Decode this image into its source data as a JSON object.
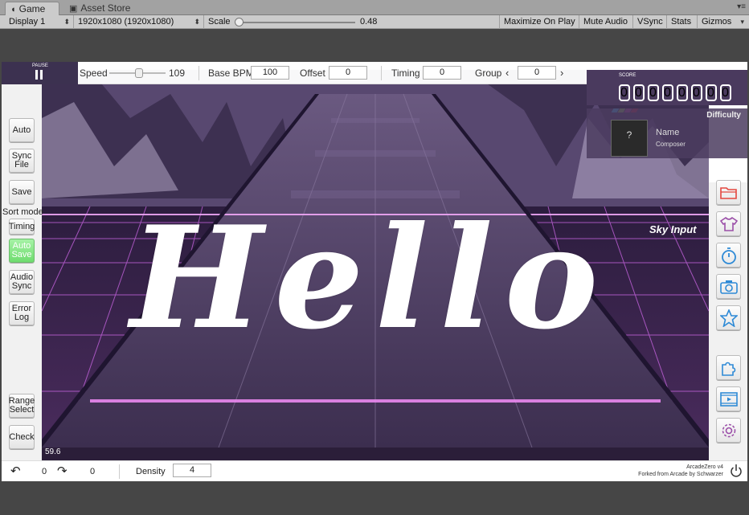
{
  "unity": {
    "tabs": [
      {
        "label": "Game",
        "icon": "pacman-icon"
      },
      {
        "label": "Asset Store",
        "icon": "bag-icon"
      }
    ],
    "toolbar": {
      "display": "Display 1",
      "resolution": "1920x1080 (1920x1080)",
      "scale_label": "Scale",
      "scale_value": "0.48",
      "scale_fraction": 0.0,
      "maximize": "Maximize On Play",
      "mute": "Mute Audio",
      "vsync": "VSync",
      "stats": "Stats",
      "gizmos": "Gizmos"
    }
  },
  "topbar": {
    "pause_label": "PAUSE",
    "speed_label": "Speed",
    "speed_value": "109",
    "speed_fraction": 0.5,
    "base_bpm_label": "Base BPM",
    "base_bpm_value": "100",
    "offset_label": "Offset",
    "offset_value": "0",
    "timing_label": "Timing",
    "timing_value": "0",
    "group_label": "Group",
    "group_value": "0"
  },
  "score": {
    "label": "SCORE",
    "digits": [
      "0",
      "0",
      "0",
      "0",
      "0",
      "0",
      "0",
      "0"
    ],
    "difficulty_label": "Difficulty",
    "song_name": "Name",
    "composer": "Composer",
    "jacket_glyph": "?"
  },
  "scene": {
    "overlay_text": "Hello",
    "sky_input": "Sky Input",
    "fps": "59.6"
  },
  "left_buttons": [
    {
      "label1": "Auto",
      "label2": ""
    },
    {
      "label1": "Sync",
      "label2": "File"
    },
    {
      "label1": "Save",
      "label2": ""
    },
    {
      "label1": "Timing",
      "label2": ""
    },
    {
      "label1": "Auto",
      "label2": "Save"
    },
    {
      "label1": "Audio",
      "label2": "Sync"
    },
    {
      "label1": "Error",
      "label2": "Log"
    },
    {
      "label1": "Range",
      "label2": "Select"
    },
    {
      "label1": "Check",
      "label2": ""
    }
  ],
  "sort_mode_label": "Sort mode",
  "right_buttons": [
    "folder-icon",
    "shirt-icon",
    "stopwatch-icon",
    "camera-icon",
    "star-icon",
    "puzzle-icon",
    "film-icon",
    "gear-icon"
  ],
  "bottombar": {
    "undo_count": "0",
    "redo_count": "0",
    "density_label": "Density",
    "density_value": "4",
    "version": "ArcadeZero v4",
    "credit": "Forked from Arcade by Schwarzer"
  },
  "colors": {
    "auto_save_active": "#7ee07e",
    "icon_red": "#e4473f",
    "icon_purple": "#9b4fa8",
    "icon_blue": "#2e8ad6"
  }
}
